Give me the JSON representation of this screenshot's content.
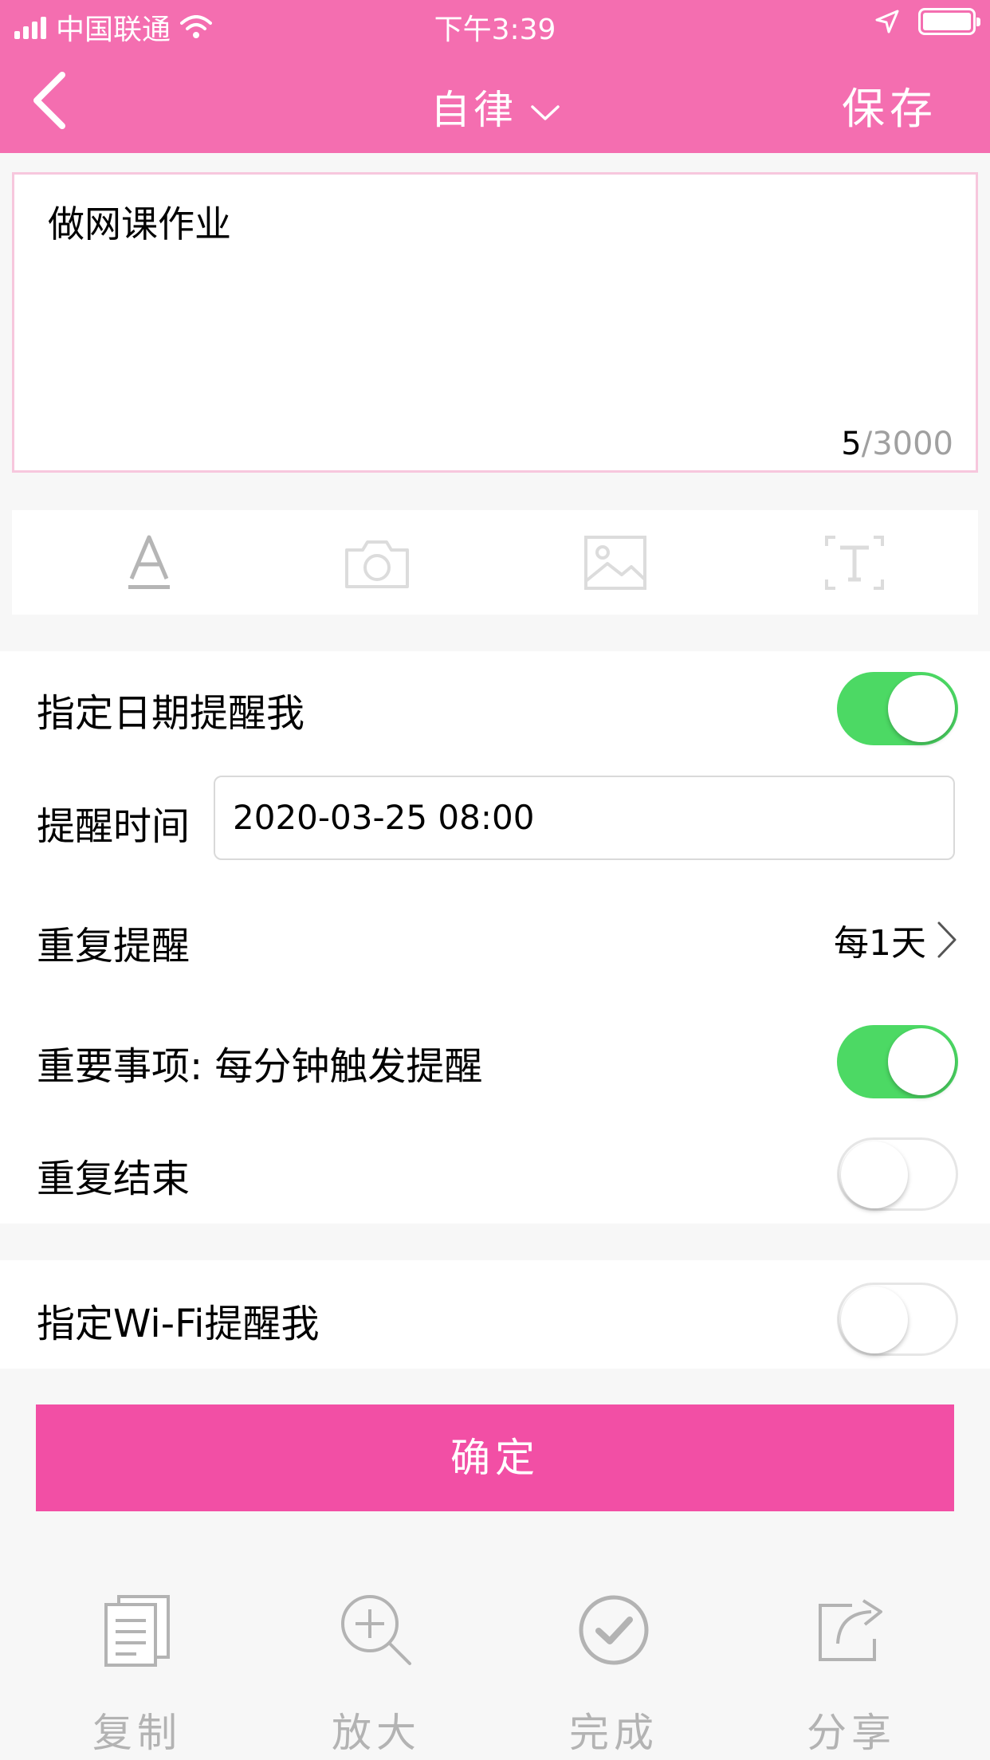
{
  "status_bar": {
    "carrier": "中国联通",
    "time": "下午3:39"
  },
  "nav": {
    "category": "自律",
    "save_label": "保存"
  },
  "editor": {
    "content": "做网课作业",
    "char_count": "5",
    "char_limit": "/3000"
  },
  "toolbar": {
    "icons": [
      "text-format-icon",
      "camera-icon",
      "image-icon",
      "text-box-icon"
    ]
  },
  "reminder": {
    "date_label": "指定日期提醒我",
    "date_enabled": true,
    "time_label": "提醒时间",
    "time_value": "2020-03-25 08:00",
    "repeat_label": "重复提醒",
    "repeat_value": "每1天",
    "important_label": "重要事项: 每分钟触发提醒",
    "important_enabled": true,
    "repeat_end_label": "重复结束",
    "repeat_end_enabled": false
  },
  "wifi": {
    "label": "指定Wi-Fi提醒我",
    "enabled": false
  },
  "confirm_label": "确定",
  "bottom_actions": [
    {
      "label": "复制",
      "icon": "copy-icon"
    },
    {
      "label": "放大",
      "icon": "zoom-in-icon"
    },
    {
      "label": "完成",
      "icon": "check-circle-icon"
    },
    {
      "label": "分享",
      "icon": "share-icon"
    }
  ],
  "colors": {
    "header": "#f46eb0",
    "confirm_button": "#f24fa5",
    "toggle_on": "#4cd964"
  }
}
